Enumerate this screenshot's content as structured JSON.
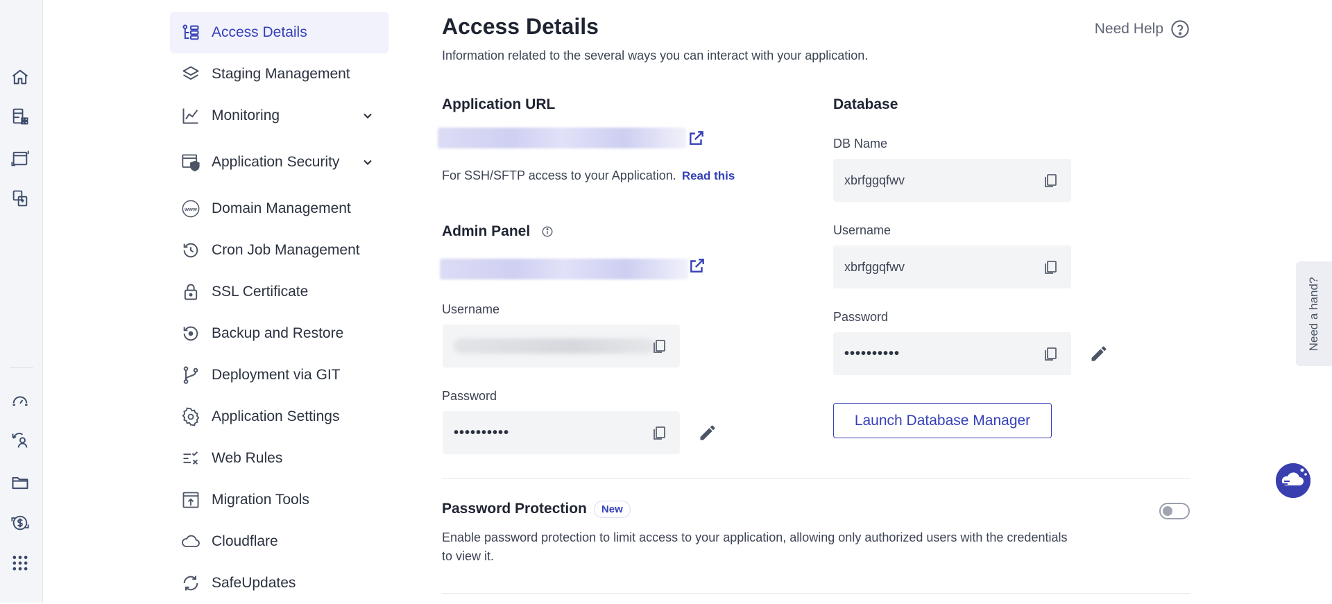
{
  "nav": {
    "items": [
      {
        "label": "Access Details",
        "icon": "access-details-icon",
        "active": true
      },
      {
        "label": "Staging Management",
        "icon": "layers-icon"
      },
      {
        "label": "Monitoring",
        "icon": "chart-line-icon",
        "expandable": true
      },
      {
        "label": "Application Security",
        "icon": "shield-window-icon",
        "expandable": true
      },
      {
        "label": "Domain Management",
        "icon": "www-globe-icon"
      },
      {
        "label": "Cron Job Management",
        "icon": "history-clock-icon"
      },
      {
        "label": "SSL Certificate",
        "icon": "lock-icon"
      },
      {
        "label": "Backup and Restore",
        "icon": "backup-restore-icon"
      },
      {
        "label": "Deployment via GIT",
        "icon": "git-branch-icon"
      },
      {
        "label": "Application Settings",
        "icon": "gear-icon"
      },
      {
        "label": "Web Rules",
        "icon": "rules-list-icon"
      },
      {
        "label": "Migration Tools",
        "icon": "migration-upload-icon"
      },
      {
        "label": "Cloudflare",
        "icon": "cloud-icon"
      },
      {
        "label": "SafeUpdates",
        "icon": "refresh-icon"
      }
    ]
  },
  "header": {
    "title": "Access Details",
    "description": "Information related to the several ways you can interact with your application.",
    "help_label": "Need Help"
  },
  "app_url": {
    "title": "Application URL",
    "ssh_text": "For SSH/SFTP access to your Application.",
    "read_this": "Read this"
  },
  "admin_panel": {
    "title": "Admin Panel",
    "username_label": "Username",
    "password_label": "Password",
    "password_value": "••••••••••"
  },
  "database": {
    "title": "Database",
    "db_name_label": "DB Name",
    "db_name_value": "xbrfggqfwv",
    "username_label": "Username",
    "username_value": "xbrfggqfwv",
    "password_label": "Password",
    "password_value": "••••••••••",
    "launch_label": "Launch Database Manager"
  },
  "password_protection": {
    "title": "Password Protection",
    "badge": "New",
    "description": "Enable password protection to limit access to your application, allowing only authorized users with the credentials to view it.",
    "enabled": false
  },
  "floating": {
    "need_hand": "Need a hand?"
  },
  "colors": {
    "accent": "#3540b8",
    "active_bg": "#f1f2fb",
    "field_bg": "#f3f4f6"
  }
}
